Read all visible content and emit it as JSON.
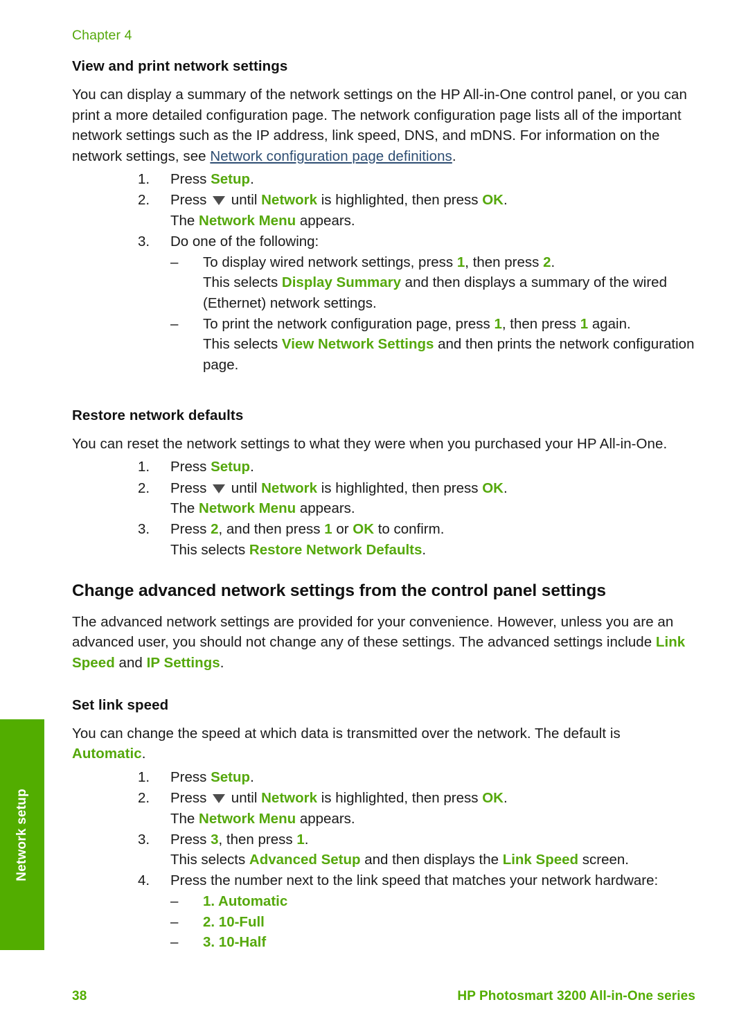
{
  "running_head": {
    "chapter": "Chapter 4"
  },
  "side_tab": {
    "label": "Network setup",
    "color": "#52ad00"
  },
  "colors": {
    "ui_term_green": "#55a80c",
    "tab_green": "#52ad00",
    "xref_blue": "#2e4e73",
    "body_text": "#1a1a1a"
  },
  "sections": {
    "view_and_print": {
      "heading": "View and print network settings",
      "intro": {
        "part1": "You can display a summary of the network settings on the HP All-in-One control panel, or you can print a more detailed configuration page. The network configuration page lists all of the important network settings such as the IP address, link speed, DNS, and mDNS. For information on the network settings, see ",
        "xref": "Network configuration page definitions",
        "part2": "."
      },
      "steps": {
        "s1_num": "1.",
        "s1_a": "Press ",
        "s1_setup": "Setup",
        "s1_b": ".",
        "s2_num": "2.",
        "s2_a": "Press ",
        "s2_b": " until ",
        "s2_network": "Network",
        "s2_c": " is highlighted, then press ",
        "s2_ok": "OK",
        "s2_d": ".",
        "s2_line2_a": "The ",
        "s2_line2_menu": "Network Menu",
        "s2_line2_b": " appears.",
        "s3_num": "3.",
        "s3_text": "Do one of the following:",
        "b1_dash": "–",
        "b1_a": "To display wired network settings, press ",
        "b1_n1": "1",
        "b1_b": ", then press ",
        "b1_n2": "2",
        "b1_c": ".",
        "b1_line2_a": "This selects ",
        "b1_line2_ui": "Display Summary",
        "b1_line2_b": " and then displays a summary of the wired (Ethernet) network settings.",
        "b2_dash": "–",
        "b2_a": "To print the network configuration page, press ",
        "b2_n1": "1",
        "b2_b": ", then press ",
        "b2_n2": "1",
        "b2_c": " again.",
        "b2_line2_a": "This selects ",
        "b2_line2_ui": "View Network Settings",
        "b2_line2_b": " and then prints the network configuration page."
      }
    },
    "restore_defaults": {
      "heading": "Restore network defaults",
      "intro": "You can reset the network settings to what they were when you purchased your HP All-in-One.",
      "steps": {
        "s1_num": "1.",
        "s1_a": "Press ",
        "s1_setup": "Setup",
        "s1_b": ".",
        "s2_num": "2.",
        "s2_a": "Press ",
        "s2_b": " until ",
        "s2_network": "Network",
        "s2_c": " is highlighted, then press ",
        "s2_ok": "OK",
        "s2_d": ".",
        "s2_line2_a": "The ",
        "s2_line2_menu": "Network Menu",
        "s2_line2_b": " appears.",
        "s3_num": "3.",
        "s3_a": "Press ",
        "s3_n2": "2",
        "s3_b": ", and then press ",
        "s3_n1": "1",
        "s3_c": " or ",
        "s3_ok": "OK",
        "s3_d": " to confirm.",
        "s3_line2_a": "This selects ",
        "s3_line2_ui": "Restore Network Defaults",
        "s3_line2_b": "."
      }
    },
    "change_advanced": {
      "heading": "Change advanced network settings from the control panel settings",
      "intro": {
        "part1": "The advanced network settings are provided for your convenience. However, unless you are an advanced user, you should not change any of these settings. The advanced settings include ",
        "ui1": "Link Speed",
        "part2": " and ",
        "ui2": "IP Settings",
        "part3": "."
      }
    },
    "set_link_speed": {
      "heading": "Set link speed",
      "intro": {
        "part1": "You can change the speed at which data is transmitted over the network. The default is ",
        "ui1": "Automatic",
        "part2": "."
      },
      "steps": {
        "s1_num": "1.",
        "s1_a": "Press ",
        "s1_setup": "Setup",
        "s1_b": ".",
        "s2_num": "2.",
        "s2_a": "Press ",
        "s2_b": " until ",
        "s2_network": "Network",
        "s2_c": " is highlighted, then press ",
        "s2_ok": "OK",
        "s2_d": ".",
        "s2_line2_a": "The ",
        "s2_line2_menu": "Network Menu",
        "s2_line2_b": " appears.",
        "s3_num": "3.",
        "s3_a": "Press ",
        "s3_n3": "3",
        "s3_b": ", then press ",
        "s3_n1": "1",
        "s3_c": ".",
        "s3_line2_a": "This selects ",
        "s3_line2_ui1": "Advanced Setup",
        "s3_line2_b": " and then displays the ",
        "s3_line2_ui2": "Link Speed",
        "s3_line2_c": " screen.",
        "s4_num": "4.",
        "s4_text": "Press the number next to the link speed that matches your network hardware:",
        "opt_dash": "–",
        "opt1": "1. Automatic",
        "opt2": "2. 10-Full",
        "opt3": "3. 10-Half"
      }
    }
  },
  "footer": {
    "page_number": "38",
    "product": "HP Photosmart 3200 All-in-One series"
  }
}
